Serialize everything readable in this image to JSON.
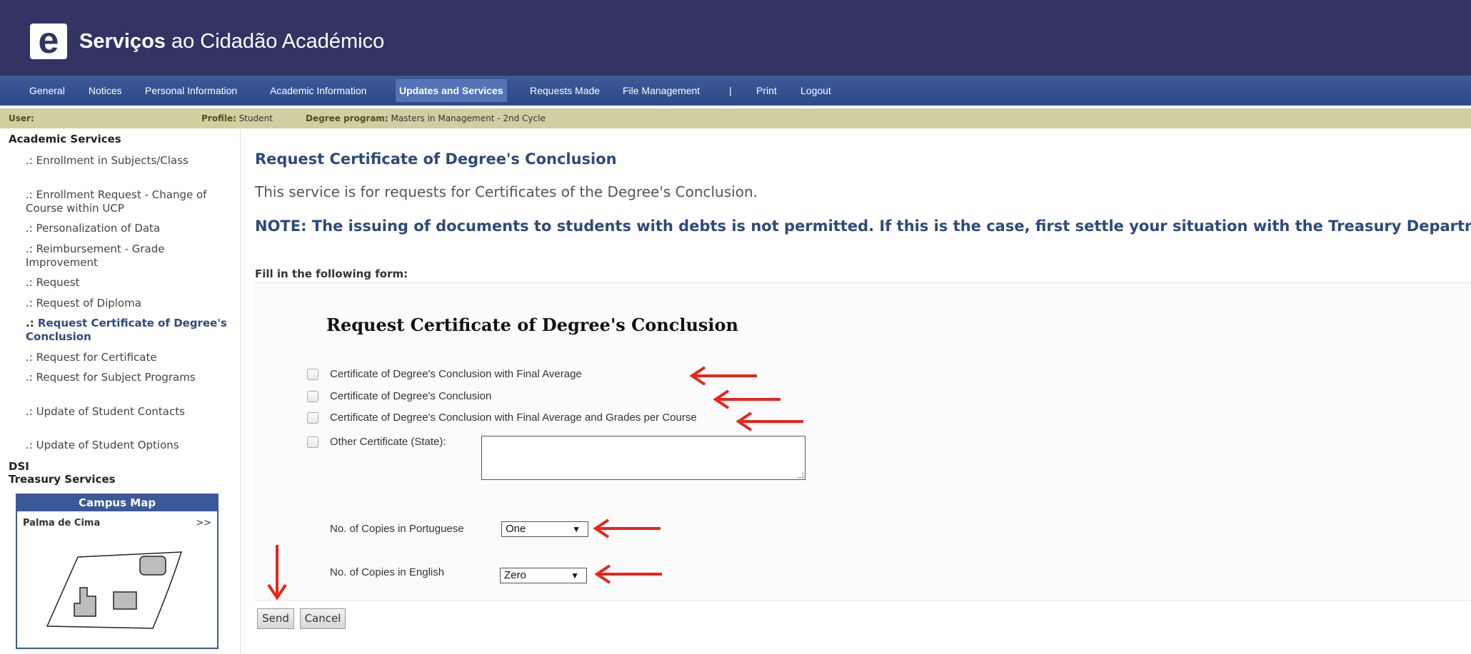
{
  "header": {
    "logo_letter": "e",
    "title_bold": "Serviços",
    "title_rest": " ao Cidadão Académico",
    "brand_color": "#323463"
  },
  "nav": {
    "items": [
      "General",
      "Notices",
      "Personal Information",
      "Academic Information",
      "Updates and Services",
      "Requests Made",
      "File Management",
      "|",
      "Print",
      "Logout"
    ],
    "active": "Updates and Services"
  },
  "userbar": {
    "user_label": "User:",
    "profile_label": "Profile:",
    "profile_value": " Student",
    "degree_label": "Degree program:",
    "degree_value": " Masters in Management - 2nd Cycle"
  },
  "sidebar": {
    "heading": "Academic Services",
    "bullet": ".: ",
    "items": [
      "Enrollment in Subjects/Class",
      "Enrollment Request - Change of Course within UCP",
      "Personalization of Data",
      "Reimbursement - Grade Improvement",
      "Request",
      "Request of Diploma",
      "Request Certificate of Degree's Conclusion",
      "Request for Certificate",
      "Request for Subject Programs",
      "Update of Student Contacts",
      "Update of Student Options"
    ],
    "current": "Request Certificate of Degree's Conclusion",
    "heading_dsi": "DSI",
    "heading_treasury": "Treasury Services",
    "campus": {
      "title": "Campus Map",
      "location": "Palma de Cima",
      "more": ">>"
    }
  },
  "main": {
    "title": "Request Certificate of Degree's Conclusion",
    "description": "This service is for requests for Certificates of the Degree's Conclusion.",
    "note": "NOTE: The issuing of documents to students with debts is not permitted. If this is the case, first settle your situation with the Treasury Department.",
    "form_label": "Fill in the following form:"
  },
  "form": {
    "title": "Request Certificate of Degree's Conclusion",
    "options": [
      "Certificate of Degree's Conclusion with Final Average",
      "Certificate of Degree's Conclusion",
      "Certificate of Degree's Conclusion with Final Average and Grades per Course",
      "Other Certificate (State):"
    ],
    "copies_pt_label": "No. of Copies in Portuguese",
    "copies_pt_value": "One",
    "copies_en_label": "No. of Copies in English",
    "copies_en_value": "Zero",
    "dropdown_glyph": "▼",
    "send": "Send",
    "cancel": "Cancel"
  },
  "annotation_color": "#e8241c"
}
